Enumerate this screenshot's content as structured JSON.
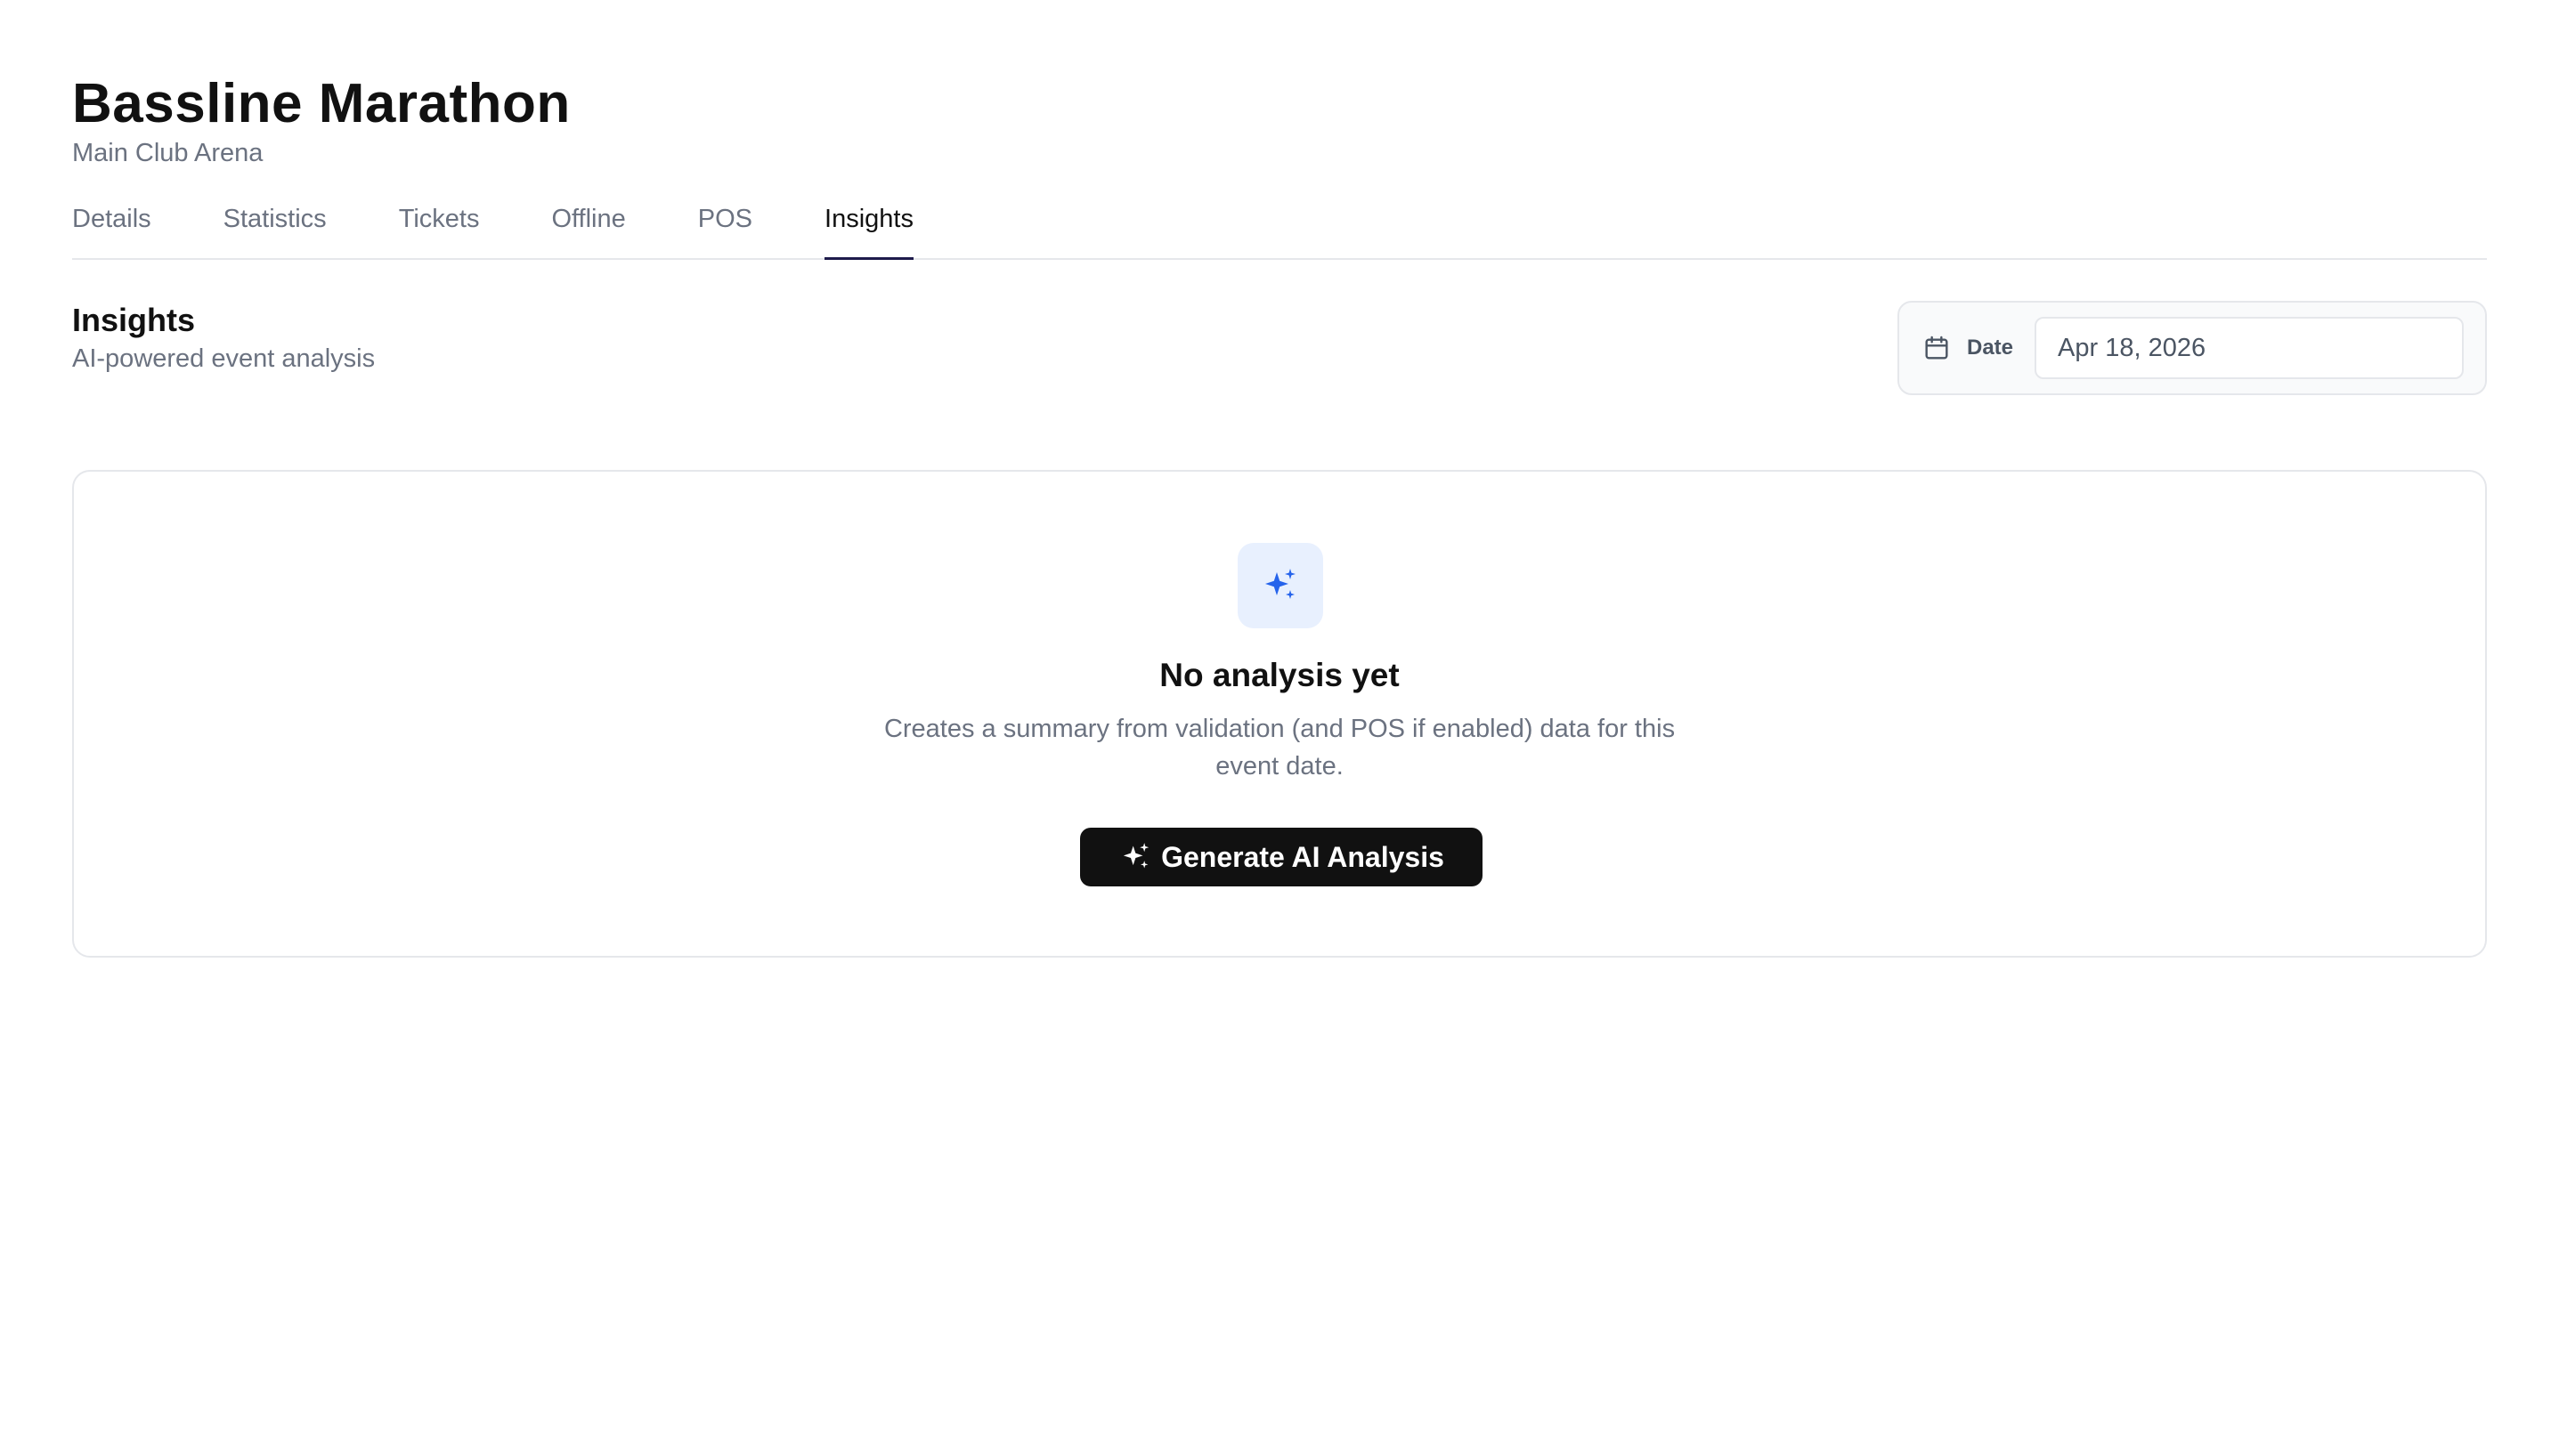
{
  "event": {
    "title": "Bassline Marathon",
    "venue": "Main Club Arena"
  },
  "tabs": [
    {
      "label": "Details",
      "active": false
    },
    {
      "label": "Statistics",
      "active": false
    },
    {
      "label": "Tickets",
      "active": false
    },
    {
      "label": "Offline",
      "active": false
    },
    {
      "label": "POS",
      "active": false
    },
    {
      "label": "Insights",
      "active": true
    }
  ],
  "insights": {
    "title": "Insights",
    "subtitle": "AI-powered event analysis",
    "date_label": "Date",
    "date_value": "Apr 18, 2026",
    "date_icon": "calendar-icon"
  },
  "empty_state": {
    "icon": "sparkles-icon",
    "title": "No analysis yet",
    "description": "Creates a summary from validation (and POS if enabled) data for this event date.",
    "button_label": "Generate AI Analysis",
    "button_icon": "sparkles-icon"
  },
  "colors": {
    "accent_blue": "#2563eb",
    "icon_bg": "#e8f0fe",
    "button_bg": "#111111",
    "tab_underline": "#1e1b4b",
    "muted_text": "#6b7280",
    "border": "#e5e7eb"
  }
}
